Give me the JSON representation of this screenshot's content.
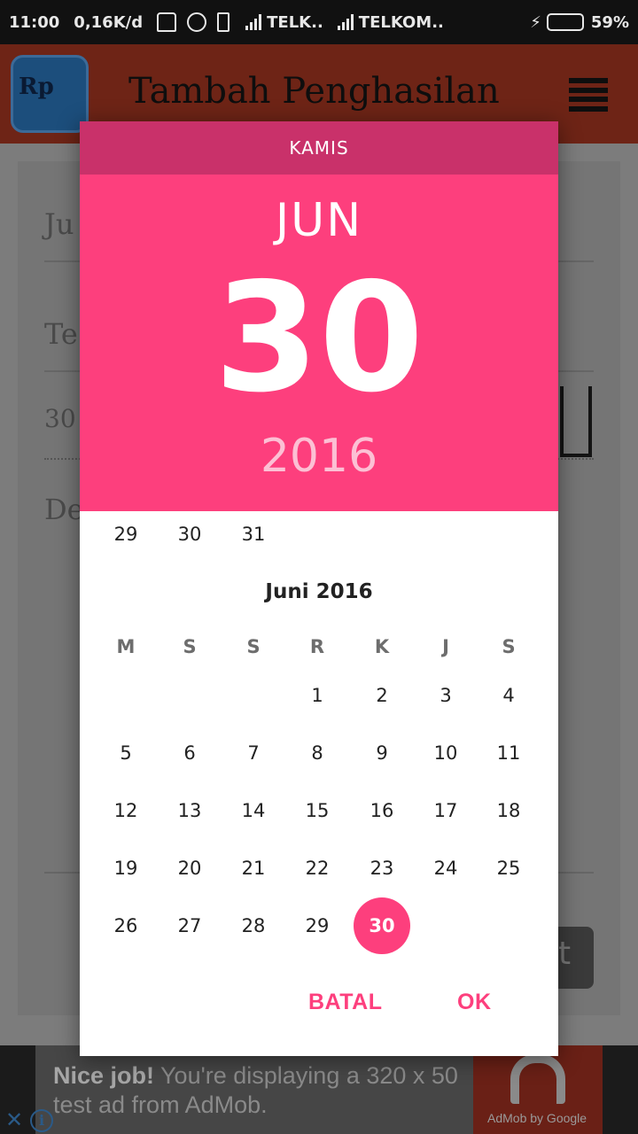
{
  "status_bar": {
    "time": "11:00",
    "speed": "0,16K/d",
    "carrier1": "TELK..",
    "carrier2": "TELKOM..",
    "battery": "59%",
    "battery_level": 0.59
  },
  "app": {
    "logo_text": "Rp",
    "title": "Tambah Penghasilan"
  },
  "form_fragments": {
    "field1": "Ju",
    "field2": "Te",
    "field3": "30",
    "field4": "De",
    "button": "t"
  },
  "date_picker": {
    "day_of_week": "KAMIS",
    "month_short": "JUN",
    "day": "30",
    "year": "2016",
    "prev_month_tail": [
      "29",
      "30",
      "31"
    ],
    "month_title": "Juni 2016",
    "weekday_headers": [
      "M",
      "S",
      "S",
      "R",
      "K",
      "J",
      "S"
    ],
    "weeks": [
      [
        "",
        "",
        "",
        "1",
        "2",
        "3",
        "4"
      ],
      [
        "5",
        "6",
        "7",
        "8",
        "9",
        "10",
        "11"
      ],
      [
        "12",
        "13",
        "14",
        "15",
        "16",
        "17",
        "18"
      ],
      [
        "19",
        "20",
        "21",
        "22",
        "23",
        "24",
        "25"
      ],
      [
        "26",
        "27",
        "28",
        "29",
        "30",
        "",
        ""
      ]
    ],
    "selected_day": "30",
    "cancel_label": "BATAL",
    "ok_label": "OK"
  },
  "ad": {
    "headline": "Nice job!",
    "body": "You're displaying a 320 x 50 test ad from AdMob.",
    "brand": "AdMob by Google",
    "close_symbol": "✕",
    "info_symbol": "i"
  },
  "colors": {
    "accent": "#fd3f7d",
    "header_dark": "#c9316a",
    "year_muted": "#fcc0d4"
  }
}
